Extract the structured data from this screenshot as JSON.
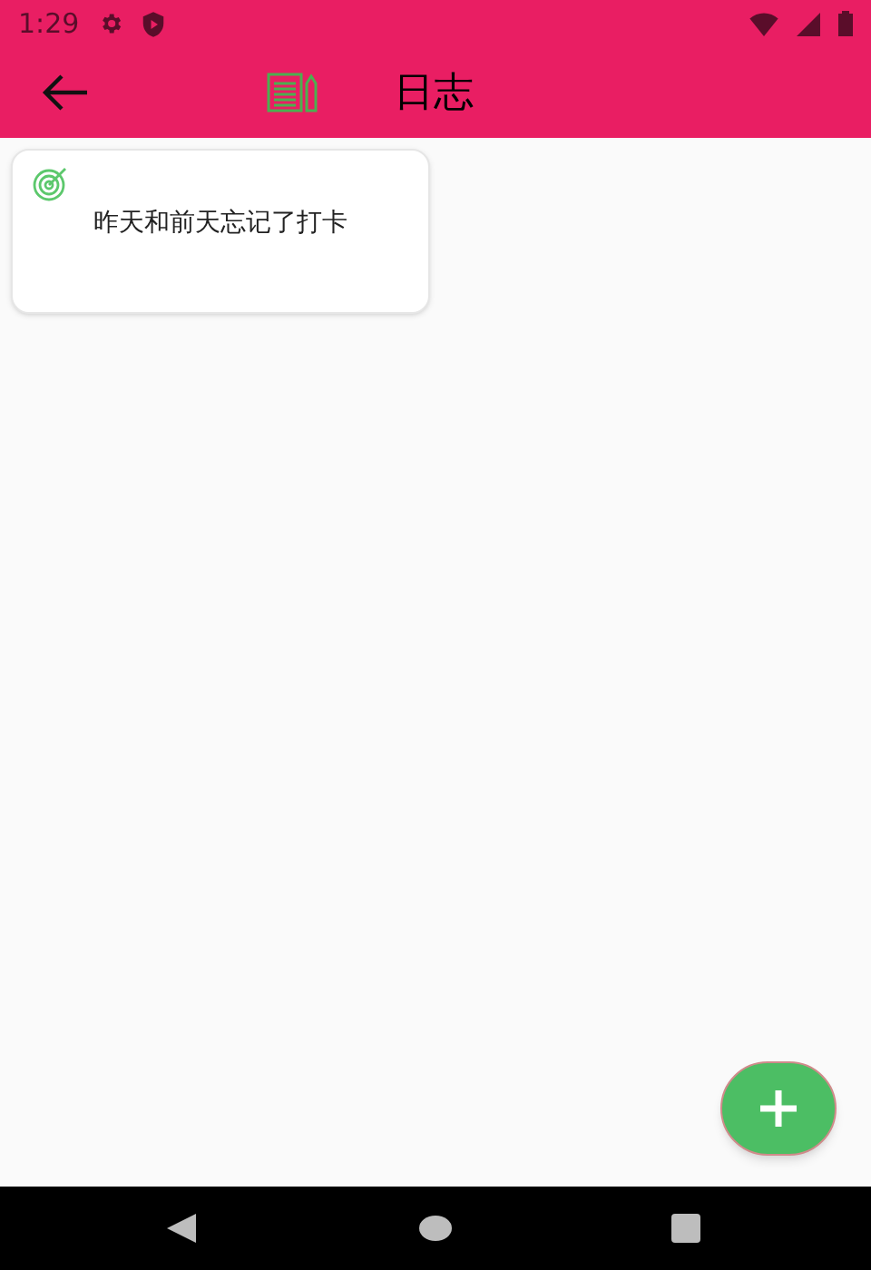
{
  "status_bar": {
    "time": "1:29"
  },
  "app_bar": {
    "title": "日志"
  },
  "entries": [
    {
      "text": "昨天和前天忘记了打卡"
    }
  ]
}
